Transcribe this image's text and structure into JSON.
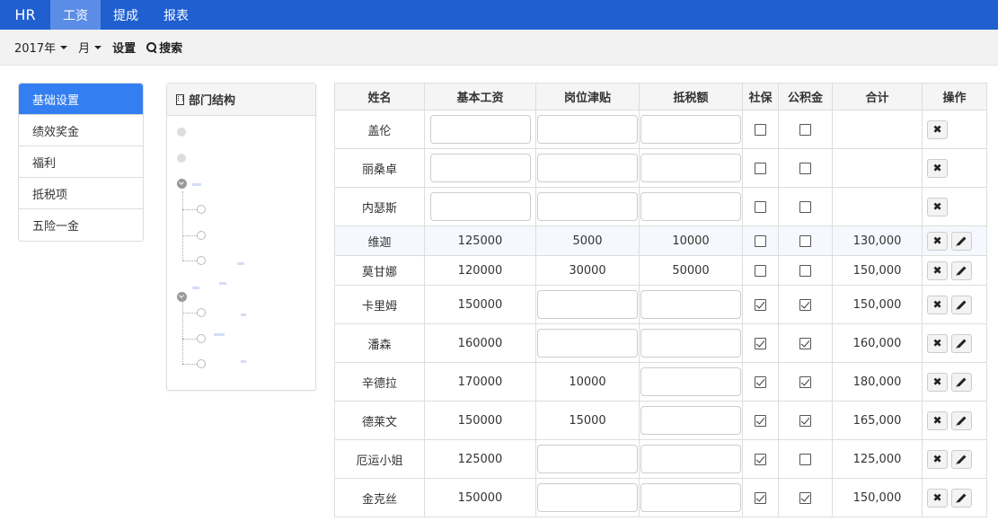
{
  "nav": {
    "brand": "HR",
    "items": [
      {
        "label": "工资",
        "active": true
      },
      {
        "label": "提成",
        "active": false
      },
      {
        "label": "报表",
        "active": false
      }
    ]
  },
  "toolbar": {
    "year": "2017年",
    "month": "月",
    "settings": "设置",
    "search": "搜索"
  },
  "sidebar": {
    "items": [
      {
        "label": "基础设置",
        "active": true
      },
      {
        "label": "绩效奖金",
        "active": false
      },
      {
        "label": "福利",
        "active": false
      },
      {
        "label": "抵税项",
        "active": false
      },
      {
        "label": "五险一金",
        "active": false
      }
    ]
  },
  "dept": {
    "title": "部门结构"
  },
  "table": {
    "headers": [
      "姓名",
      "基本工资",
      "岗位津贴",
      "抵税额",
      "社保",
      "公积金",
      "合计",
      "操作"
    ],
    "rows": [
      {
        "name": "盖伦",
        "base": "",
        "allowance": "",
        "tax": "",
        "ss": false,
        "fund": false,
        "total": "",
        "edit": false
      },
      {
        "name": "丽桑卓",
        "base": "",
        "allowance": "",
        "tax": "",
        "ss": false,
        "fund": false,
        "total": "",
        "edit": false
      },
      {
        "name": "内瑟斯",
        "base": "",
        "allowance": "",
        "tax": "",
        "ss": false,
        "fund": false,
        "total": "",
        "edit": false
      },
      {
        "name": "维迦",
        "base": "125000",
        "allowance": "5000",
        "tax": "10000",
        "ss": false,
        "fund": false,
        "total": "130,000",
        "edit": true
      },
      {
        "name": "莫甘娜",
        "base": "120000",
        "allowance": "30000",
        "tax": "50000",
        "ss": false,
        "fund": false,
        "total": "150,000",
        "edit": true
      },
      {
        "name": "卡里姆",
        "base": "150000",
        "allowance": "",
        "tax": "",
        "ss": true,
        "fund": true,
        "total": "150,000",
        "edit": true
      },
      {
        "name": "潘森",
        "base": "160000",
        "allowance": "",
        "tax": "",
        "ss": true,
        "fund": true,
        "total": "160,000",
        "edit": true
      },
      {
        "name": "辛德拉",
        "base": "170000",
        "allowance": "10000",
        "tax": "",
        "ss": true,
        "fund": true,
        "total": "180,000",
        "edit": true
      },
      {
        "name": "德莱文",
        "base": "150000",
        "allowance": "15000",
        "tax": "",
        "ss": true,
        "fund": true,
        "total": "165,000",
        "edit": true
      },
      {
        "name": "厄运小姐",
        "base": "125000",
        "allowance": "",
        "tax": "",
        "ss": true,
        "fund": false,
        "total": "125,000",
        "edit": true
      },
      {
        "name": "金克丝",
        "base": "150000",
        "allowance": "",
        "tax": "",
        "ss": true,
        "fund": true,
        "total": "150,000",
        "edit": true
      }
    ]
  }
}
